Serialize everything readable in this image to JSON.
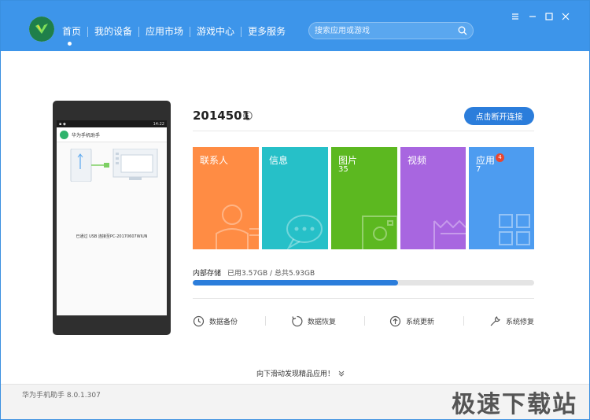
{
  "header": {
    "nav": [
      "首页",
      "我的设备",
      "应用市场",
      "游戏中心",
      "更多服务"
    ],
    "search_placeholder": "搜索应用或游戏"
  },
  "phone": {
    "time": "14:22",
    "app_title": "华为手机助手",
    "message": "已通过 USB 连接至PC-20170607WIUN"
  },
  "device": {
    "name": "2014501",
    "disconnect_label": "点击断开连接"
  },
  "tiles": [
    {
      "label": "联系人",
      "count": "",
      "color": "#ff8c44"
    },
    {
      "label": "信息",
      "count": "",
      "color": "#26c0c8"
    },
    {
      "label": "图片",
      "count": "35",
      "color": "#5cb820"
    },
    {
      "label": "视频",
      "count": "",
      "color": "#a866e0"
    },
    {
      "label": "应用",
      "count": "7",
      "color": "#4d9cf0",
      "badge": "4"
    }
  ],
  "storage": {
    "label": "内部存储",
    "detail": "已用3.57GB / 总共5.93GB",
    "used_fraction": 0.602
  },
  "actions": [
    {
      "label": "数据备份",
      "icon": "backup-icon"
    },
    {
      "label": "数据恢复",
      "icon": "restore-icon"
    },
    {
      "label": "系统更新",
      "icon": "update-icon"
    },
    {
      "label": "系统修复",
      "icon": "wrench-icon"
    }
  ],
  "scroll_hint": "向下滑动发现精品应用！",
  "footer": {
    "version": "华为手机助手 8.0.1.307",
    "watermark": "极速下载站"
  }
}
